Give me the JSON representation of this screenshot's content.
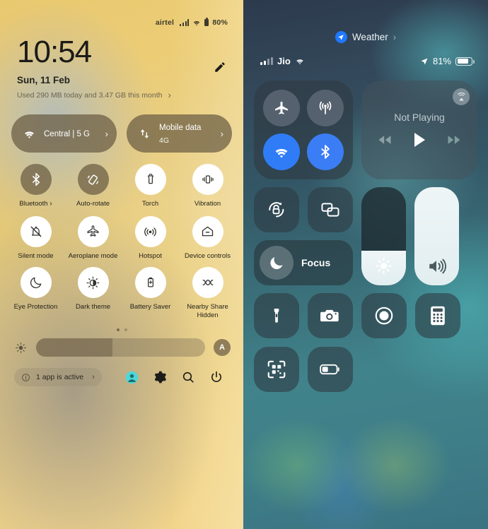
{
  "android": {
    "status_bar": {
      "carrier": "airtel",
      "battery_percent": "80%",
      "icons": [
        "signal-bars-icon",
        "wifi-icon",
        "battery-icon"
      ]
    },
    "clock": {
      "time": "10:54",
      "date": "Sun, 11 Feb",
      "data_usage": "Used 290 MB today and 3.47 GB this month",
      "chevron": "›"
    },
    "edit_button": {
      "name": "edit-pencil-icon"
    },
    "pills": [
      {
        "icon": "wifi-icon",
        "line1": "Central | 5 G",
        "line2": "",
        "chevron": "›"
      },
      {
        "icon": "mobile-data-icon",
        "line1": "Mobile data",
        "line2": "4G",
        "chevron": "›"
      }
    ],
    "tiles": [
      {
        "label": "Bluetooth",
        "sub": "",
        "icon": "bluetooth-icon",
        "state": "off",
        "chevron": "›"
      },
      {
        "label": "Auto-rotate",
        "sub": "",
        "icon": "auto-rotate-icon",
        "state": "off",
        "chevron": ""
      },
      {
        "label": "Torch",
        "sub": "",
        "icon": "torch-icon",
        "state": "on",
        "chevron": ""
      },
      {
        "label": "Vibration",
        "sub": "",
        "icon": "vibration-icon",
        "state": "on",
        "chevron": ""
      },
      {
        "label": "Silent mode",
        "sub": "",
        "icon": "bell-off-icon",
        "state": "on",
        "chevron": ""
      },
      {
        "label": "Aeroplane mode",
        "sub": "",
        "icon": "airplane-icon",
        "state": "on",
        "chevron": ""
      },
      {
        "label": "Hotspot",
        "sub": "",
        "icon": "hotspot-icon",
        "state": "on",
        "chevron": ""
      },
      {
        "label": "Device controls",
        "sub": "",
        "icon": "home-icon",
        "state": "on",
        "chevron": ""
      },
      {
        "label": "Eye Protection",
        "sub": "",
        "icon": "moon-icon",
        "state": "on",
        "chevron": ""
      },
      {
        "label": "Dark theme",
        "sub": "",
        "icon": "dark-theme-icon",
        "state": "on",
        "chevron": ""
      },
      {
        "label": "Battery Saver",
        "sub": "",
        "icon": "battery-saver-icon",
        "state": "on",
        "chevron": ""
      },
      {
        "label": "Nearby Share",
        "sub": "Hidden",
        "icon": "nearby-share-icon",
        "state": "on",
        "chevron": ""
      }
    ],
    "pagination": {
      "total": 2,
      "active": 1
    },
    "brightness": {
      "icon": "brightness-icon",
      "value_percent": 45,
      "auto_label": "A"
    },
    "footer": {
      "active_apps_label": "1 app is active",
      "active_apps_icon": "info-icon",
      "active_apps_chevron": "›",
      "icons": [
        "user-avatar-icon",
        "settings-gear-icon",
        "search-icon",
        "power-icon"
      ]
    },
    "colors": {
      "tile_on_bg": "#ffffff",
      "tile_off_bg": "#6a5c42",
      "accent": "#4dd8d8"
    }
  },
  "ios": {
    "weather": {
      "label": "Weather",
      "chevron": "›",
      "badge_icon": "location-arrow-icon"
    },
    "status_bar": {
      "carrier": "Jio",
      "battery_percent": "81%",
      "location_icon": "location-arrow-icon",
      "wifi_icon": "wifi-icon"
    },
    "connectivity": [
      {
        "name": "airplane-mode-button",
        "icon": "airplane-icon",
        "state": "off"
      },
      {
        "name": "cellular-data-button",
        "icon": "cellular-antenna-icon",
        "state": "off"
      },
      {
        "name": "wifi-button",
        "icon": "wifi-icon",
        "state": "on"
      },
      {
        "name": "bluetooth-button",
        "icon": "bluetooth-icon",
        "state": "on"
      }
    ],
    "media": {
      "title": "Not Playing",
      "airplay_icon": "airplay-icon",
      "controls": [
        "rewind-icon",
        "play-icon",
        "fastforward-icon"
      ]
    },
    "rotation_lock": {
      "icon": "rotation-lock-icon"
    },
    "screen_mirroring": {
      "icon": "screen-mirroring-icon"
    },
    "focus": {
      "label": "Focus",
      "icon": "moon-icon"
    },
    "brightness_slider": {
      "icon": "brightness-icon",
      "value_percent": 35
    },
    "volume_slider": {
      "icon": "volume-icon",
      "value_percent": 100
    },
    "tiles": [
      {
        "name": "flashlight-button",
        "icon": "flashlight-icon"
      },
      {
        "name": "camera-button",
        "icon": "camera-icon"
      },
      {
        "name": "screen-record-button",
        "icon": "record-icon"
      },
      {
        "name": "calculator-button",
        "icon": "calculator-icon"
      },
      {
        "name": "qr-scanner-button",
        "icon": "qr-code-icon"
      },
      {
        "name": "low-power-mode-button",
        "icon": "low-battery-icon"
      }
    ],
    "colors": {
      "active_blue": "#2f7cf6",
      "slider_fill": "#eef5f7"
    }
  }
}
